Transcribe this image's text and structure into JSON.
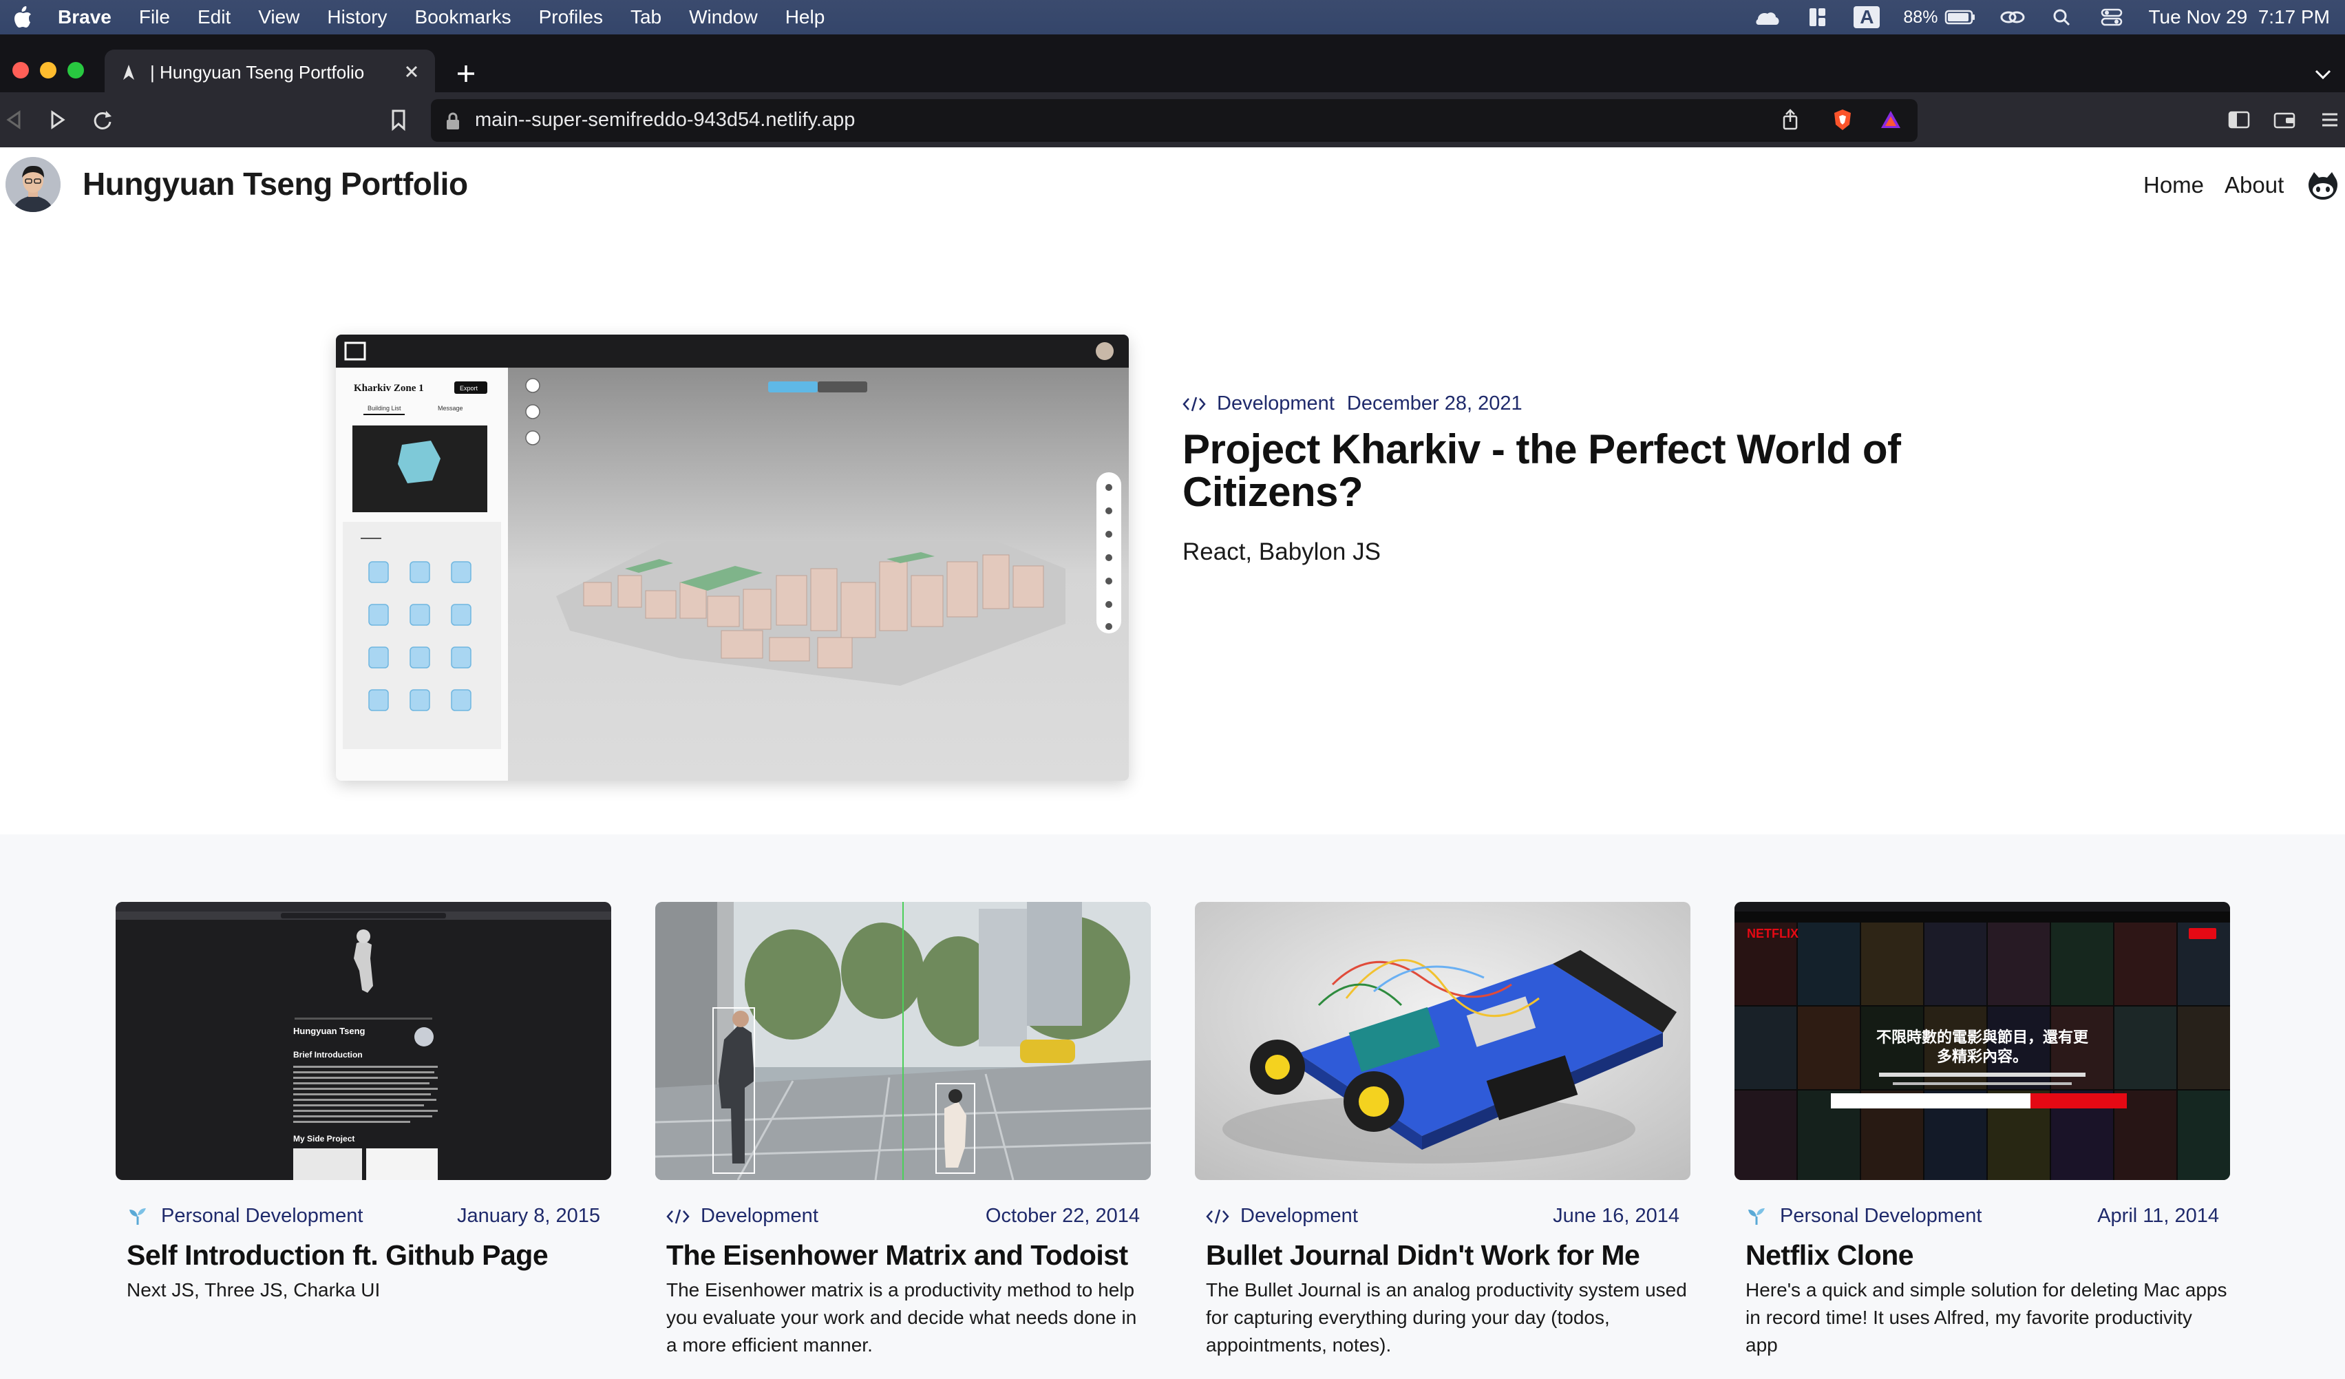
{
  "menubar": {
    "app": "Brave",
    "items": [
      "File",
      "Edit",
      "View",
      "History",
      "Bookmarks",
      "Profiles",
      "Tab",
      "Window",
      "Help"
    ],
    "battery": "88%",
    "clock": "Tue Nov 29  7:17 PM",
    "input_indicator": "A"
  },
  "browser": {
    "tab_title": "| Hungyuan Tseng Portfolio",
    "url": "main--super-semifreddo-943d54.netlify.app"
  },
  "site": {
    "title": "Hungyuan Tseng Portfolio",
    "nav": [
      "Home",
      "About"
    ]
  },
  "featured": {
    "category": "Development",
    "date": "December 28, 2021",
    "title": "Project Kharkiv - the Perfect World of Citizens?",
    "tags": "React, Babylon JS",
    "screenshot": {
      "panel_title": "Kharkiv Zone 1",
      "tab_building": "Building List",
      "tab_message": "Message",
      "export": "Export"
    }
  },
  "posts": [
    {
      "category": "Personal Development",
      "icon": "seedling-icon",
      "date": "January 8, 2015",
      "title": "Self Introduction ft. Github Page",
      "desc": "Next JS, Three JS, Charka UI",
      "thumb": {
        "name": "Hungyuan Tseng",
        "heading": "Brief Introduction",
        "sub": "My Side Project"
      }
    },
    {
      "category": "Development",
      "icon": "code-icon",
      "date": "October 22, 2014",
      "title": "The Eisenhower Matrix and Todoist",
      "desc": "The Eisenhower matrix is a productivity method to help you evaluate your work and decide what needs done in a more efficient manner."
    },
    {
      "category": "Development",
      "icon": "code-icon",
      "date": "June 16, 2014",
      "title": "Bullet Journal Didn't Work for Me",
      "desc": "The Bullet Journal is an analog productivity system used for capturing everything during your day (todos, appointments, notes)."
    },
    {
      "category": "Personal Development",
      "icon": "seedling-icon",
      "date": "April 11, 2014",
      "title": "Netflix Clone",
      "desc": "Here's a quick and simple solution for deleting Mac apps in record time! It uses Alfred, my favorite productivity app",
      "thumb": {
        "brand": "NETFLIX",
        "headline1": "不限時數的電影與節目，還有更",
        "headline2": "多精彩內容。"
      }
    }
  ],
  "colors": {
    "accent": "#1f2a6b",
    "menubar": "#34456a",
    "section_bg": "#f7f8fa"
  }
}
